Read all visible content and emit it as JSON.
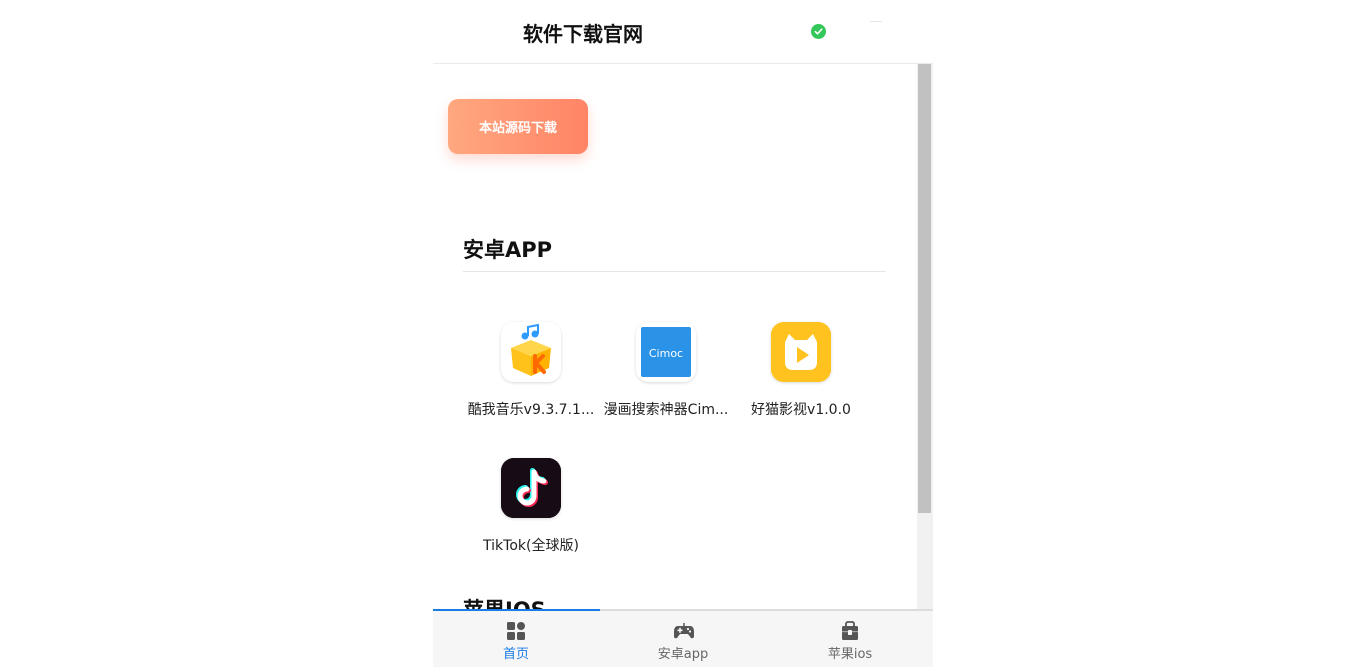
{
  "header": {
    "title": "软件下载官网"
  },
  "source_button": {
    "label": "本站源码下载"
  },
  "sections": [
    {
      "title": "安卓APP"
    },
    {
      "title": "苹果IOS"
    }
  ],
  "android_apps": [
    {
      "name": "酷我音乐v9.3.7.1...",
      "icon": "kuwo-music-icon"
    },
    {
      "name": "漫画搜索神器Cim...",
      "icon": "cimoc-icon",
      "icon_text": "Cimoc"
    },
    {
      "name": "好猫影视v1.0.0",
      "icon": "haomao-video-icon"
    },
    {
      "name": "TikTok(全球版)",
      "icon": "tiktok-icon"
    }
  ],
  "tabs": [
    {
      "label": "首页",
      "icon": "home-grid-icon",
      "active": true
    },
    {
      "label": "安卓app",
      "icon": "gamepad-icon",
      "active": false
    },
    {
      "label": "苹果ios",
      "icon": "lock-box-icon",
      "active": false
    }
  ],
  "colors": {
    "accent": "#1a7ce6",
    "button_gradient_start": "#ffa880",
    "button_gradient_end": "#ff8466",
    "verified": "#34c759"
  }
}
